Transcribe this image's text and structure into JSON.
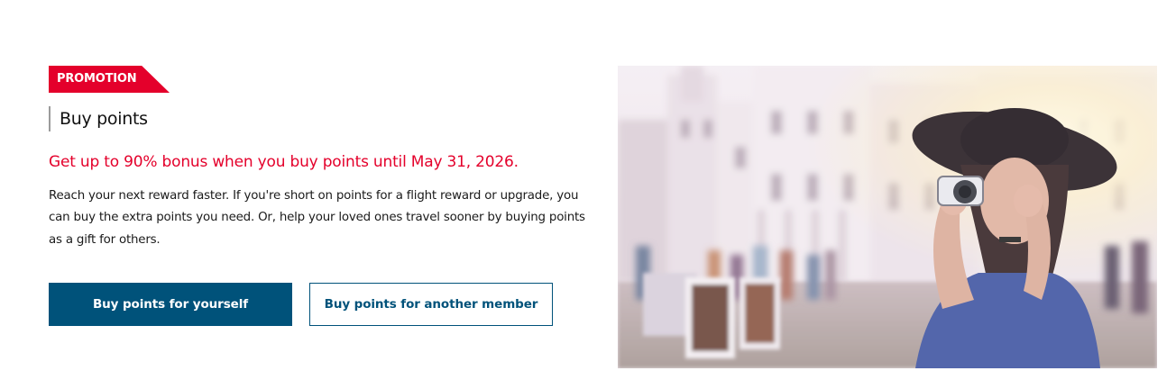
{
  "promo": {
    "tag": "PROMOTION",
    "title": "Buy points",
    "headline": "Get up to 90% bonus when you buy points until May 31, 2026.",
    "description": "Reach your next reward faster. If you're short on points for a flight reward or upgrade, you can buy the extra points you need. Or, help your loved ones travel sooner by buying points as a gift for others."
  },
  "buttons": {
    "primary_label": "Buy points for yourself",
    "secondary_label": "Buy points for another member"
  },
  "image": {
    "alt": "Woman with hat taking a photo in front of a historic building"
  },
  "colors": {
    "accent_red": "#e4002b",
    "brand_blue": "#00527a"
  }
}
